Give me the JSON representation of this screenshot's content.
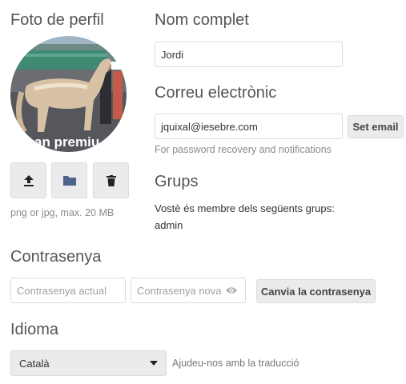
{
  "profile_picture": {
    "title": "Foto de perfil",
    "avatar_overlay_text": "an premiu",
    "hint": "png or jpg, max. 20 MB",
    "upload_icon": "upload-icon",
    "folder_icon": "folder-icon",
    "delete_icon": "trash-icon"
  },
  "full_name": {
    "title": "Nom complet",
    "value": "Jordi"
  },
  "email": {
    "title": "Correu electrònic",
    "value": "jquixal@iesebre.com",
    "button_label": "Set email",
    "hint": "For password recovery and notifications"
  },
  "groups": {
    "title": "Grups",
    "description": "Vostè és membre dels següents grups:",
    "list": "admin"
  },
  "password": {
    "title": "Contrasenya",
    "current_placeholder": "Contrasenya actual",
    "new_placeholder": "Contrasenya nova",
    "show_icon": "eye-icon",
    "button_label": "Canvia la contrasenya"
  },
  "language": {
    "title": "Idioma",
    "selected": "Català",
    "help_link": "Ajudeu-nos amb la traducció"
  },
  "colors": {
    "accent_folder": "#4c6489",
    "button_bg": "#ebebeb",
    "border": "#dbdbdb"
  }
}
